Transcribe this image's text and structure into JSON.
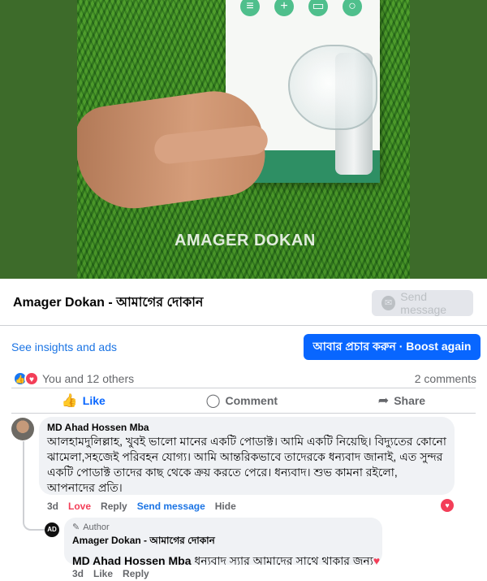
{
  "media": {
    "watermark": "AMAGER DOKAN"
  },
  "page_bar": {
    "page_name": "Amager Dokan - আমাগের দোকান",
    "send_message": "Send message"
  },
  "insights_link": "See insights and ads",
  "boost_button": "আবার প্রচার করুন · Boost again",
  "reactions": {
    "summary": "You and 12 others",
    "comments_count": "2 comments"
  },
  "actions": {
    "like": "Like",
    "comment": "Comment",
    "share": "Share"
  },
  "comment1": {
    "author": "MD Ahad Hossen Mba",
    "text": "আলহামদুলিল্লাহ, খুবই ভালো মানের একটি পোডাক্ট। আমি একটি নিয়েছি। বিদ্যুতের কোনো ঝামেলা,সহজেই পরিবহন যোগ্য। আমি আন্তরিকভাবে তাদেরকে ধন্যবাদ জানাই, এত সুন্দর একটি পোডাক্ট তাদের কাছ থেকে ক্রয় করতে পেরে। ধন্যবাদ। শুভ কামনা রইলো, আপনাদের প্রতি।",
    "time": "3d",
    "love": "Love",
    "reply": "Reply",
    "send_message": "Send message",
    "hide": "Hide"
  },
  "comment2": {
    "badge": "Author",
    "author": "Amager Dokan - আমাগের দোকান",
    "mention": "MD Ahad Hossen Mba",
    "text": " ধন্যবাদ স্যার আমাদের সাথে থাকার জন্য",
    "time": "3d",
    "like": "Like",
    "reply": "Reply",
    "avatar_text": "AD"
  }
}
